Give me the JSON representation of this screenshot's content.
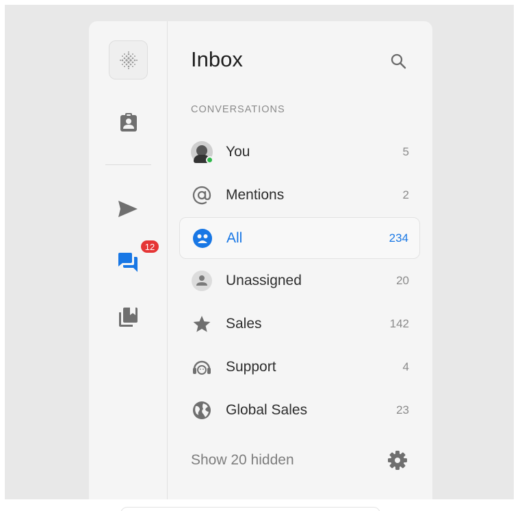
{
  "header": {
    "title": "Inbox"
  },
  "section": {
    "label": "CONVERSATIONS"
  },
  "rail": {
    "notification_count": "12"
  },
  "items": [
    {
      "label": "You",
      "count": "5",
      "icon": "user-avatar"
    },
    {
      "label": "Mentions",
      "count": "2",
      "icon": "at-icon"
    },
    {
      "label": "All",
      "count": "234",
      "icon": "group-icon",
      "active": true
    },
    {
      "label": "Unassigned",
      "count": "20",
      "icon": "person-circle-icon"
    },
    {
      "label": "Sales",
      "count": "142",
      "icon": "star-icon"
    },
    {
      "label": "Support",
      "count": "4",
      "icon": "headset-icon"
    },
    {
      "label": "Global Sales",
      "count": "23",
      "icon": "globe-icon"
    }
  ],
  "footer": {
    "hidden_label": "Show 20 hidden"
  },
  "colors": {
    "accent": "#1877e5",
    "badge": "#e53535",
    "online": "#2fb84a"
  }
}
